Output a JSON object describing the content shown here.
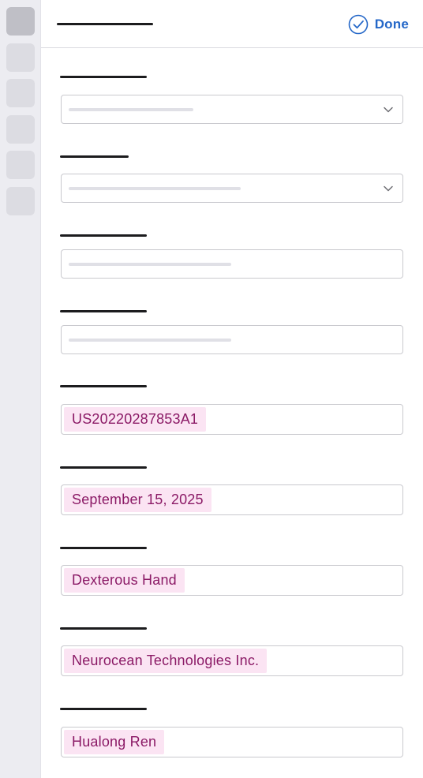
{
  "header": {
    "done_label": "Done"
  },
  "icons": {
    "done": "check-circle-icon",
    "dropdown": "chevron-down-icon"
  },
  "colors": {
    "accent": "#2467c8",
    "chip_background": "#fbe4f3",
    "chip_text": "#8b1a66"
  },
  "fields": {
    "patent_number": "US20220287853A1",
    "date": "September 15, 2025",
    "title": "Dexterous Hand",
    "assignee": "Neurocean Technologies Inc.",
    "inventor": "Hualong Ren"
  }
}
